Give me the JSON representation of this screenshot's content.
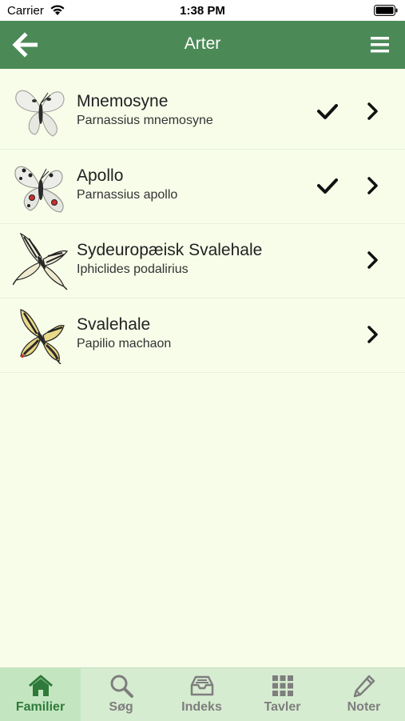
{
  "status": {
    "carrier": "Carrier",
    "time": "1:38 PM"
  },
  "nav": {
    "title": "Arter"
  },
  "species": [
    {
      "name": "Mnemosyne",
      "latin": "Parnassius mnemosyne",
      "checked": true
    },
    {
      "name": "Apollo",
      "latin": "Parnassius apollo",
      "checked": true
    },
    {
      "name": "Sydeuropæisk Svalehale",
      "latin": "Iphiclides podalirius",
      "checked": false
    },
    {
      "name": "Svalehale",
      "latin": "Papilio machaon",
      "checked": false
    }
  ],
  "tabs": [
    {
      "label": "Familier",
      "icon": "home-icon",
      "active": true
    },
    {
      "label": "Søg",
      "icon": "search-icon",
      "active": false
    },
    {
      "label": "Indeks",
      "icon": "inbox-icon",
      "active": false
    },
    {
      "label": "Tavler",
      "icon": "grid-icon",
      "active": false
    },
    {
      "label": "Noter",
      "icon": "pencil-icon",
      "active": false
    }
  ],
  "colors": {
    "nav": "#4b8a57",
    "background": "#f7fde9",
    "tabbar": "#d6ecd0",
    "active_tab": "#2f7a3a"
  }
}
